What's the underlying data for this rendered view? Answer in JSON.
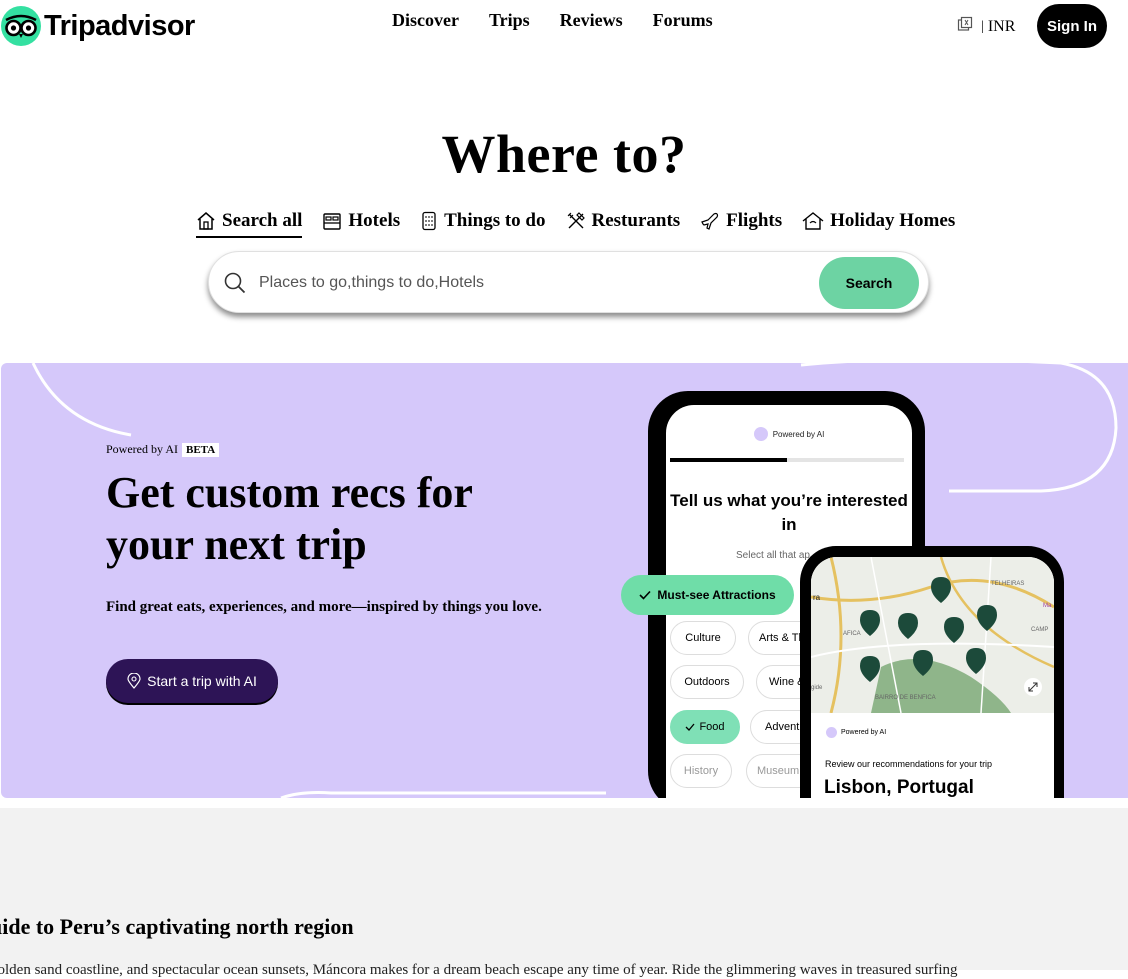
{
  "header": {
    "logo_text": "Tripadvisor",
    "nav": [
      "Discover",
      "Trips",
      "Reviews",
      "Forums"
    ],
    "currency": "INR",
    "currency_separator": "|",
    "sign_in": "Sign In"
  },
  "hero": {
    "title": "Where to?",
    "tabs": [
      {
        "label": "Search all",
        "icon": "house-icon",
        "active": true
      },
      {
        "label": "Hotels",
        "icon": "bed-icon"
      },
      {
        "label": "Things to do",
        "icon": "ticket-icon"
      },
      {
        "label": "Resturants",
        "icon": "fork-knife-icon"
      },
      {
        "label": "Flights",
        "icon": "plane-icon"
      },
      {
        "label": "Holiday Homes",
        "icon": "home-icon"
      }
    ],
    "search_placeholder": "Places to go,things to do,Hotels",
    "search_button": "Search"
  },
  "banner": {
    "powered_by": "Powered by AI",
    "beta": "BETA",
    "title": "Get custom recs for your next trip",
    "description": "Find great eats, experiences, and more—inspired by things you love.",
    "cta": "Start a trip with AI",
    "background": "#d5c8fa",
    "phone1": {
      "powered_by": "Powered by AI",
      "progress": 0.5,
      "question": "Tell us what you’re interested in",
      "select_hint": "Select all that ap",
      "highlight_chip": "Must-see Attractions",
      "chips": [
        "Culture",
        "Arts & Th",
        "Outdoors",
        "Wine &",
        "Food",
        "Advent",
        "History",
        "Museum"
      ]
    },
    "phone2": {
      "map_labels": [
        "TELHEIRAS",
        "CAMP",
        "BAIRRO DE BENFICA",
        "AFICA",
        "ra",
        "gide",
        "Ma"
      ],
      "powered_by": "Powered by AI",
      "review_text": "Review our recommendations for your trip",
      "city": "Lisbon, Portugal"
    }
  },
  "lower": {
    "title": "uide to Peru’s captivating north region",
    "description": "golden sand coastline, and spectacular ocean sunsets, Máncora makes for a dream beach escape any time of year. Ride the glimmering waves in treasured surfing"
  },
  "colors": {
    "accent_green": "#34e0a1",
    "search_button": "#6dd3a3",
    "cta_purple": "#2d1456"
  }
}
